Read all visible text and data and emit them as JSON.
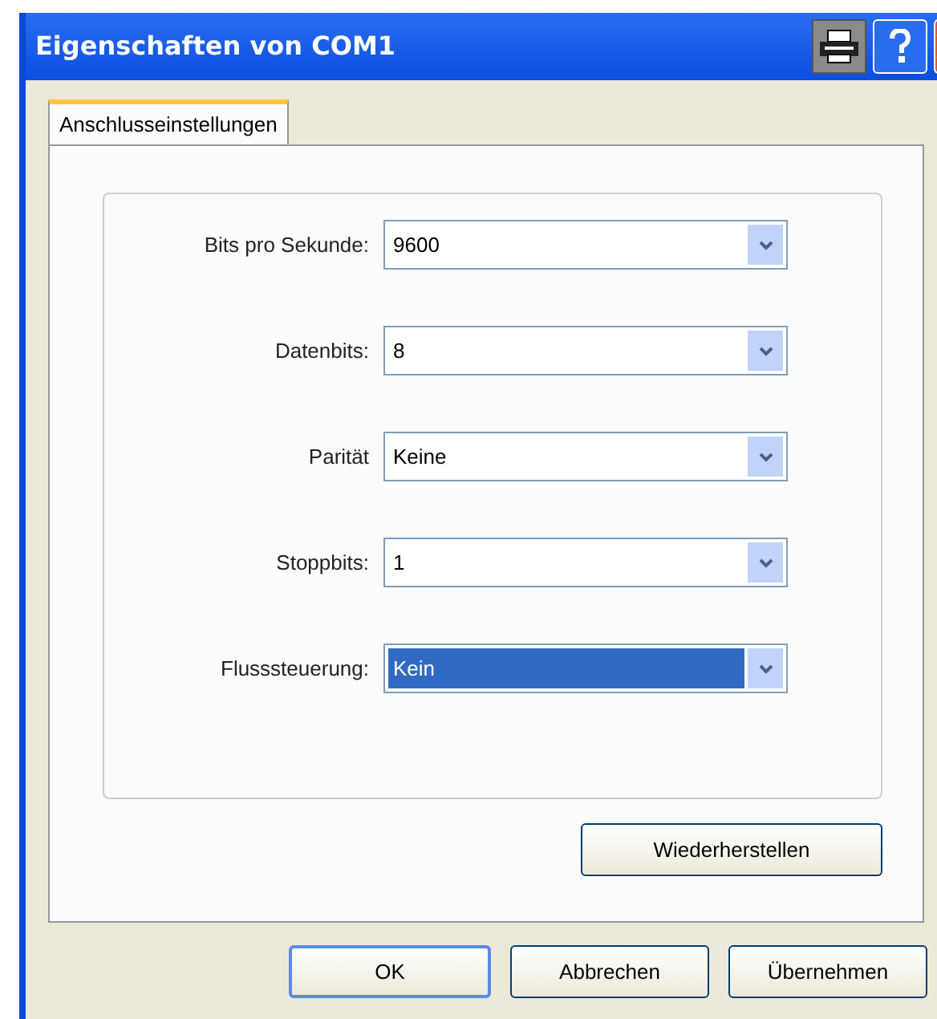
{
  "window": {
    "title": "Eigenschaften von COM1"
  },
  "tabs": [
    {
      "label": "Anschlusseinstellungen",
      "selected": true
    }
  ],
  "settings": [
    {
      "label": "Bits pro Sekunde:",
      "value": "9600",
      "focused": false
    },
    {
      "label": "Datenbits:",
      "value": "8",
      "focused": false
    },
    {
      "label": "Parität",
      "value": "Keine",
      "focused": false
    },
    {
      "label": "Stoppbits:",
      "value": "1",
      "focused": false
    },
    {
      "label": "Flusssteuerung:",
      "value": "Kein",
      "focused": true
    }
  ],
  "restore_button": "Wiederherstellen",
  "buttons": [
    {
      "label": "OK",
      "default": true
    },
    {
      "label": "Abbrechen",
      "default": false
    },
    {
      "label": "Übernehmen",
      "default": false
    }
  ]
}
